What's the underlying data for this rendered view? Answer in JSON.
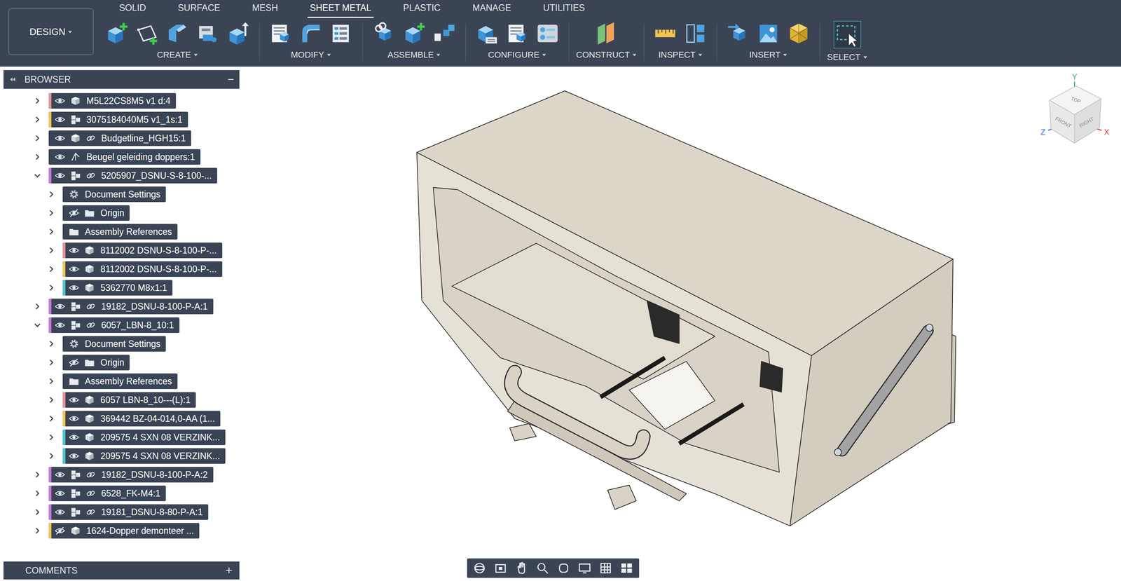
{
  "toolbar": {
    "workspace": "DESIGN",
    "tabs": [
      {
        "label": "SOLID",
        "selected": false
      },
      {
        "label": "SURFACE",
        "selected": false
      },
      {
        "label": "MESH",
        "selected": false
      },
      {
        "label": "SHEET METAL",
        "selected": true
      },
      {
        "label": "PLASTIC",
        "selected": false
      },
      {
        "label": "MANAGE",
        "selected": false
      },
      {
        "label": "UTILITIES",
        "selected": false
      }
    ],
    "groups": [
      "CREATE",
      "MODIFY",
      "ASSEMBLE",
      "CONFIGURE",
      "CONSTRUCT",
      "INSPECT",
      "INSERT",
      "SELECT"
    ]
  },
  "browser": {
    "title": "BROWSER",
    "collapse": "−",
    "rows": [
      {
        "label": "M5L22CS8M5 v1 d:4",
        "depth": 0,
        "kind": "body",
        "expanded": false,
        "visible": true,
        "linked": false,
        "color": "#e8929c"
      },
      {
        "label": "3075184040M5 v1_1s:1",
        "depth": 0,
        "kind": "component",
        "expanded": false,
        "visible": true,
        "linked": false,
        "color": "#f0c552"
      },
      {
        "label": "Budgetline_HGH15:1",
        "depth": 0,
        "kind": "body",
        "expanded": false,
        "visible": true,
        "linked": true,
        "color": null
      },
      {
        "label": "Beugel geleiding doppers:1",
        "depth": 0,
        "kind": "sketch",
        "expanded": false,
        "visible": true,
        "linked": false,
        "color": null
      },
      {
        "label": "5205907_DSNU-S-8-100-...",
        "depth": 0,
        "kind": "component",
        "expanded": true,
        "visible": true,
        "linked": true,
        "color": "#c67bd8"
      },
      {
        "label": "Document Settings",
        "depth": 1,
        "kind": "settings",
        "expanded": false,
        "visible": null,
        "linked": false,
        "color": null
      },
      {
        "label": "Origin",
        "depth": 1,
        "kind": "folder",
        "expanded": false,
        "visible": false,
        "linked": false,
        "color": null
      },
      {
        "label": "Assembly References",
        "depth": 1,
        "kind": "folder",
        "expanded": false,
        "visible": null,
        "linked": false,
        "color": null
      },
      {
        "label": "8112002 DSNU-S-8-100-P-...",
        "depth": 1,
        "kind": "body",
        "expanded": false,
        "visible": true,
        "linked": false,
        "color": "#e8929c"
      },
      {
        "label": "8112002 DSNU-S-8-100-P-...",
        "depth": 1,
        "kind": "body",
        "expanded": false,
        "visible": true,
        "linked": false,
        "color": "#f0c552"
      },
      {
        "label": "5362770 M8x1:1",
        "depth": 1,
        "kind": "body",
        "expanded": false,
        "visible": true,
        "linked": false,
        "color": "#4cc7d6"
      },
      {
        "label": "19182_DSNU-8-100-P-A:1",
        "depth": 0,
        "kind": "component",
        "expanded": false,
        "visible": true,
        "linked": true,
        "color": "#c67bd8"
      },
      {
        "label": "6057_LBN-8_10:1",
        "depth": 0,
        "kind": "component",
        "expanded": true,
        "visible": true,
        "linked": true,
        "color": "#c67bd8"
      },
      {
        "label": "Document Settings",
        "depth": 1,
        "kind": "settings",
        "expanded": false,
        "visible": null,
        "linked": false,
        "color": null
      },
      {
        "label": "Origin",
        "depth": 1,
        "kind": "folder",
        "expanded": false,
        "visible": false,
        "linked": false,
        "color": null
      },
      {
        "label": "Assembly References",
        "depth": 1,
        "kind": "folder",
        "expanded": false,
        "visible": null,
        "linked": false,
        "color": null
      },
      {
        "label": "6057 LBN-8_10---(L):1",
        "depth": 1,
        "kind": "body",
        "expanded": false,
        "visible": true,
        "linked": false,
        "color": "#e8929c"
      },
      {
        "label": "369442 BZ-04-014,0-AA (1...",
        "depth": 1,
        "kind": "body",
        "expanded": false,
        "visible": true,
        "linked": false,
        "color": "#f0c552"
      },
      {
        "label": "209575 4 SXN 08 VERZINK...",
        "depth": 1,
        "kind": "body",
        "expanded": false,
        "visible": true,
        "linked": false,
        "color": "#4cc7d6"
      },
      {
        "label": "209575 4 SXN 08 VERZINK...",
        "depth": 1,
        "kind": "body",
        "expanded": false,
        "visible": true,
        "linked": false,
        "color": "#4cc7d6"
      },
      {
        "label": "19182_DSNU-8-100-P-A:2",
        "depth": 0,
        "kind": "component",
        "expanded": false,
        "visible": true,
        "linked": true,
        "color": "#c67bd8"
      },
      {
        "label": "6528_FK-M4:1",
        "depth": 0,
        "kind": "component",
        "expanded": false,
        "visible": true,
        "linked": true,
        "color": "#c67bd8"
      },
      {
        "label": "19181_DSNU-8-80-P-A:1",
        "depth": 0,
        "kind": "component",
        "expanded": false,
        "visible": true,
        "linked": true,
        "color": "#c67bd8"
      },
      {
        "label": "1624-Dopper demonteer ...",
        "depth": 0,
        "kind": "body",
        "expanded": false,
        "visible": false,
        "linked": false,
        "color": "#f0c552"
      }
    ]
  },
  "comments": {
    "title": "COMMENTS",
    "add": "+"
  },
  "viewcube": {
    "faces": [
      "TOP",
      "FRONT",
      "RIGHT"
    ],
    "axes": [
      {
        "label": "Y",
        "color": "#3cb371"
      },
      {
        "label": "Z",
        "color": "#3b6fd6"
      },
      {
        "label": "X",
        "color": "#e0453a"
      }
    ]
  }
}
